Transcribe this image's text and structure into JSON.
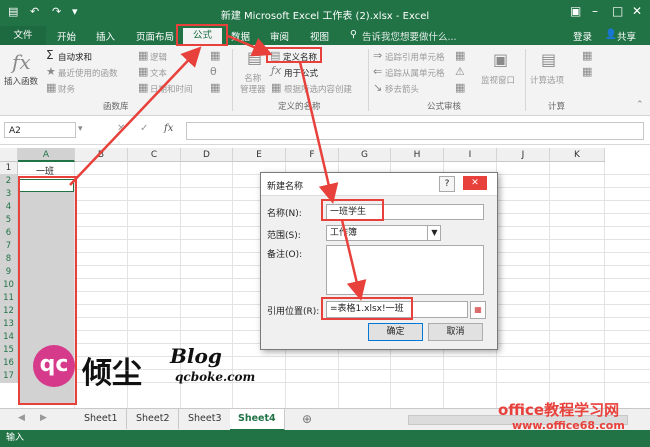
{
  "window": {
    "title": "新建 Microsoft Excel 工作表 (2).xlsx - Excel"
  },
  "tabs": {
    "file": "文件",
    "items": [
      "开始",
      "插入",
      "页面布局",
      "公式",
      "数据",
      "审阅",
      "视图"
    ],
    "active": "公式",
    "search": "告诉我您想要做什么...",
    "login": "登录",
    "share": "共享"
  },
  "ribbon": {
    "insert_function": "插入函数",
    "autosum": "自动求和",
    "recent": "最近使用的函数",
    "financial": "财务",
    "logical": "逻辑",
    "text": "文本",
    "datetime": "日期和时间",
    "group_library": "函数库",
    "name_manager": "名称\n管理器",
    "define_name": "定义名称",
    "use_in_formula": "用于公式",
    "create_from_selection": "根据所选内容创建",
    "group_defined": "定义的名称",
    "trace_precedents": "追踪引用单元格",
    "trace_dependents": "追踪从属单元格",
    "remove_arrows": "移去箭头",
    "group_audit": "公式审核",
    "watch_window": "监视窗口",
    "calc_options": "计算选项",
    "group_calc": "计算"
  },
  "formula_bar": {
    "name_box": "A2",
    "fx": "fx"
  },
  "grid": {
    "columns": [
      "A",
      "B",
      "C",
      "D",
      "E",
      "F",
      "G",
      "H",
      "I",
      "J",
      "K"
    ],
    "rows": [
      "1",
      "2",
      "3",
      "4",
      "5",
      "6",
      "7",
      "8",
      "9",
      "10",
      "11",
      "12",
      "13",
      "14",
      "15",
      "16",
      "17"
    ],
    "a1_value": "一班"
  },
  "dialog": {
    "title": "新建名称",
    "name_label": "名称(N):",
    "name_value": "一班学生",
    "scope_label": "范围(S):",
    "scope_value": "工作簿",
    "comment_label": "备注(O):",
    "ref_label": "引用位置(R):",
    "ref_value": "=表格1.xlsx!一班",
    "ok": "确定",
    "cancel": "取消",
    "help": "?"
  },
  "sheets": {
    "tabs": [
      "Sheet1",
      "Sheet2",
      "Sheet3",
      "Sheet4"
    ],
    "active": "Sheet4"
  },
  "status": {
    "mode": "输入"
  },
  "watermark": {
    "logo_mark": "qc",
    "site_name": "倾尘",
    "blog": "Blog",
    "blog_url": "qcboke.com",
    "office_brand": "office教程学习网",
    "office_url": "www.office68.com"
  },
  "colors": {
    "excel_green": "#217346",
    "annotation_red": "#e8413b"
  }
}
